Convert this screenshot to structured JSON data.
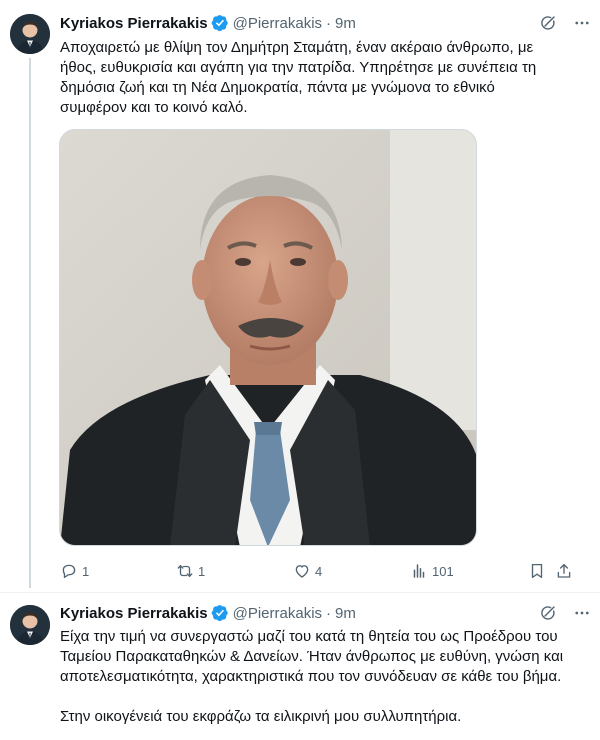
{
  "tweets": [
    {
      "author": "Kyriakos Pierrakakis",
      "handle": "@Pierrakakis",
      "time": "9m",
      "lines": [
        "Αποχαιρετώ με θλίψη τον Δημήτρη Σταμάτη, έναν ακέραιο άνθρωπο, με",
        "ήθος, ευθυκρισία και αγάπη για την πατρίδα. Υπηρέτησε με συνέπεια τη",
        "δημόσια ζωή και τη Νέα Δημοκρατία, πάντα με γνώμονα το εθνικό",
        "συμφέρον και το κοινό καλό."
      ],
      "stats": {
        "replies": "1",
        "reposts": "1",
        "likes": "4",
        "views": "101"
      }
    },
    {
      "author": "Kyriakos Pierrakakis",
      "handle": "@Pierrakakis",
      "time": "9m",
      "lines": [
        "Είχα την τιμή να συνεργαστώ μαζί του κατά τη θητεία του ως Προέδρου του",
        "Ταμείου Παρακαταθηκών & Δανείων. Ήταν άνθρωπος με ευθύνη, γνώση και",
        "αποτελεσματικότητα, χαρακτηριστικά που τον συνόδευαν σε κάθε του βήμα."
      ],
      "lines2": [
        "Στην οικογένειά του εκφράζω τα ειλικρινή μου συλλυπητήρια."
      ]
    }
  ],
  "separator": "·",
  "colors": {
    "text": "#0f1419",
    "secondary": "#536471",
    "verified": "#1d9bf0",
    "border": "#cfd9de"
  },
  "icons": [
    "verified-badge-icon",
    "grok-icon",
    "more-icon",
    "reply-icon",
    "repost-icon",
    "like-icon",
    "views-icon",
    "bookmark-icon",
    "share-icon"
  ]
}
